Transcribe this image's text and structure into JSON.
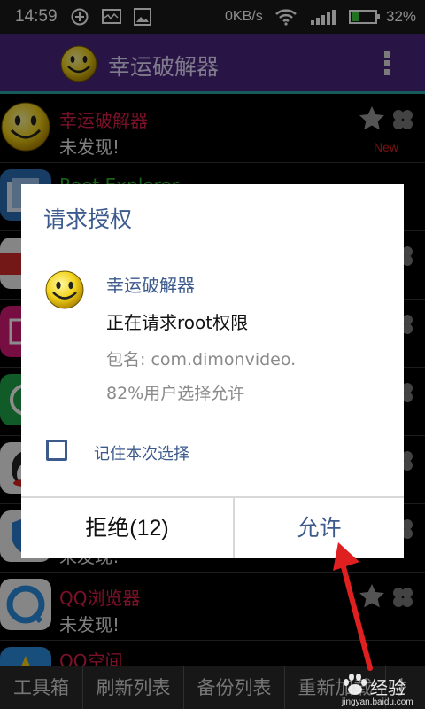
{
  "status_bar": {
    "time": "14:59",
    "network_speed": "0KB/s",
    "battery_percent": "32%",
    "battery_level": 0.32,
    "icons": [
      "add-circle-icon",
      "monitor-icon",
      "image-icon",
      "wifi-icon",
      "signal-icon",
      "battery-icon"
    ]
  },
  "app_bar": {
    "title": "幸运破解器",
    "logo_icon": "smiley-icon",
    "menu_icon": "overflow-menu-icon"
  },
  "app_list": [
    {
      "name": "幸运破解器",
      "status": "未发现!",
      "name_color": "#e0204a",
      "badge": "New",
      "icon": "smiley-icon"
    },
    {
      "name": "Root Explorer",
      "status": "",
      "name_color": "#2ab52a",
      "icon": "root-explorer-icon"
    },
    {
      "name": "",
      "status": "",
      "name_color": "#e0204a",
      "icon": "letv-icon"
    },
    {
      "name": "",
      "status": "",
      "name_color": "#e0204a",
      "icon": "pink-app-icon"
    },
    {
      "name": "",
      "status": "",
      "name_color": "#e0204a",
      "icon": "green-app-icon"
    },
    {
      "name": "",
      "status": "",
      "name_color": "#e0204a",
      "icon": "qq-penguin-icon"
    },
    {
      "name": "",
      "status": "未发现!",
      "name_color": "#e0204a",
      "icon": "shield-app-icon"
    },
    {
      "name": "QQ浏览器",
      "status": "未发现!",
      "name_color": "#e0204a",
      "icon": "qq-browser-icon"
    },
    {
      "name": "QQ空间",
      "status": "",
      "name_color": "#e0204a",
      "icon": "qzone-icon"
    }
  ],
  "tabs": [
    "工具箱",
    "刷新列表",
    "备份列表",
    "重新加载",
    "扌"
  ],
  "dialog": {
    "title": "请求授权",
    "app_name": "幸运破解器",
    "request_text": "正在请求root权限",
    "package": "包名: com.dimonvideo.",
    "percent_text": "82%用户选择允许",
    "remember_label": "记住本次选择",
    "remember_checked": false,
    "deny_label": "拒绝(12)",
    "allow_label": "允许"
  },
  "watermark": {
    "text": "经验",
    "url": "jingyan.baidu.com"
  },
  "colors": {
    "app_bar": "#4a2780",
    "accent": "#2aa8a4",
    "dialog_accent": "#3c5a8c",
    "arrow": "#e02020"
  }
}
